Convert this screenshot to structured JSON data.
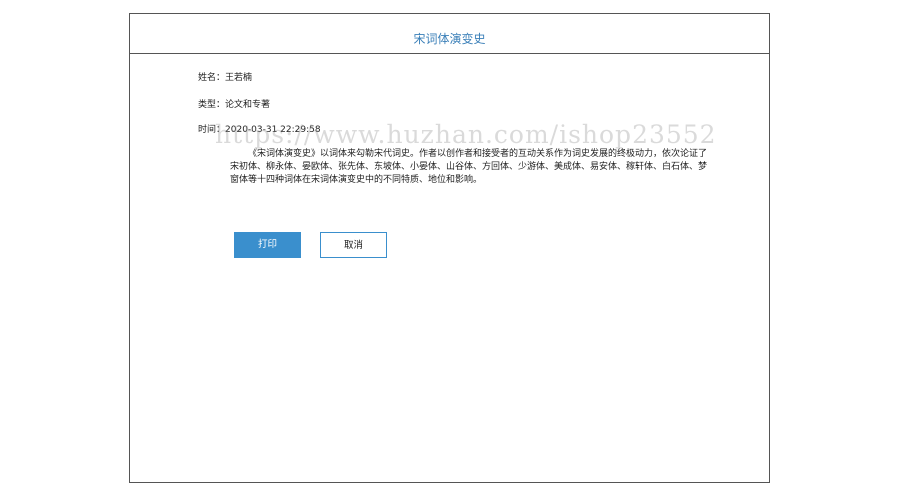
{
  "title": "宋词体演变史",
  "fields": {
    "name_label": "姓名：",
    "name": "王若楠",
    "type_label": "类型：",
    "type": "论文和专著",
    "time_label": "时间：",
    "time": "2020-03-31 22:29:58"
  },
  "description": "《宋词体演变史》以词体来勾勒宋代词史。作者以创作者和接受者的互动关系作为词史发展的终极动力，依次论证了宋初体、柳永体、晏欧体、张先体、东坡体、小晏体、山谷体、方回体、少游体、美成体、易安体、稼轩体、白石体、梦窗体等十四种词体在宋词体演变史中的不同特质、地位和影响。",
  "buttons": {
    "print": "打印",
    "cancel": "取消"
  },
  "watermark": "https://www.huzhan.com/ishop23552"
}
